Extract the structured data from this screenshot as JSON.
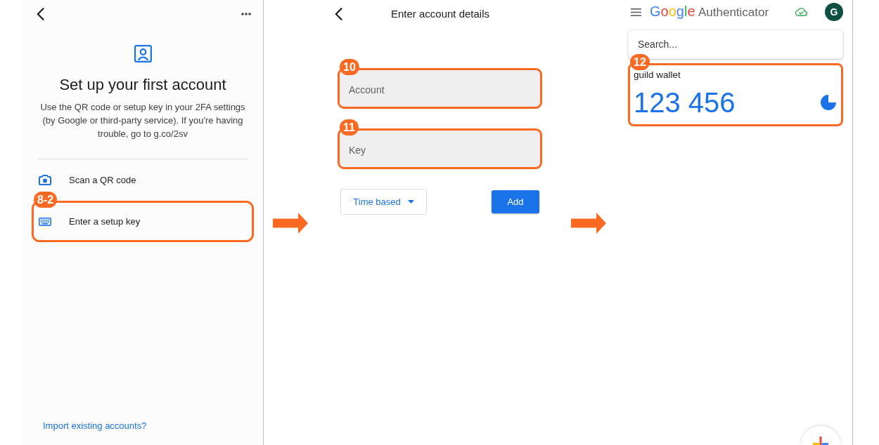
{
  "setup_screen": {
    "title": "Set up your first account",
    "description": "Use the QR code or setup key in your 2FA settings (by Google or third-party service). If you're having trouble, go to g.co/2sv",
    "options": [
      {
        "kind": "camera",
        "label": "Scan a QR code"
      },
      {
        "kind": "keyboard",
        "label": "Enter a setup key",
        "callout": "8-2"
      }
    ],
    "import_link": "Import existing accounts?"
  },
  "details_screen": {
    "title": "Enter account details",
    "fields": [
      {
        "placeholder": "Account",
        "callout": "10"
      },
      {
        "placeholder": "Key",
        "callout": "11"
      }
    ],
    "type_dropdown": "Time based",
    "add_button": "Add"
  },
  "authenticator_screen": {
    "logo": {
      "brand": "Google",
      "product": "Authenticator"
    },
    "avatar": "G",
    "search": {
      "placeholder": "Search..."
    },
    "accounts": [
      {
        "name": "guild wallet",
        "code": "123 456",
        "callout": "12"
      }
    ]
  }
}
